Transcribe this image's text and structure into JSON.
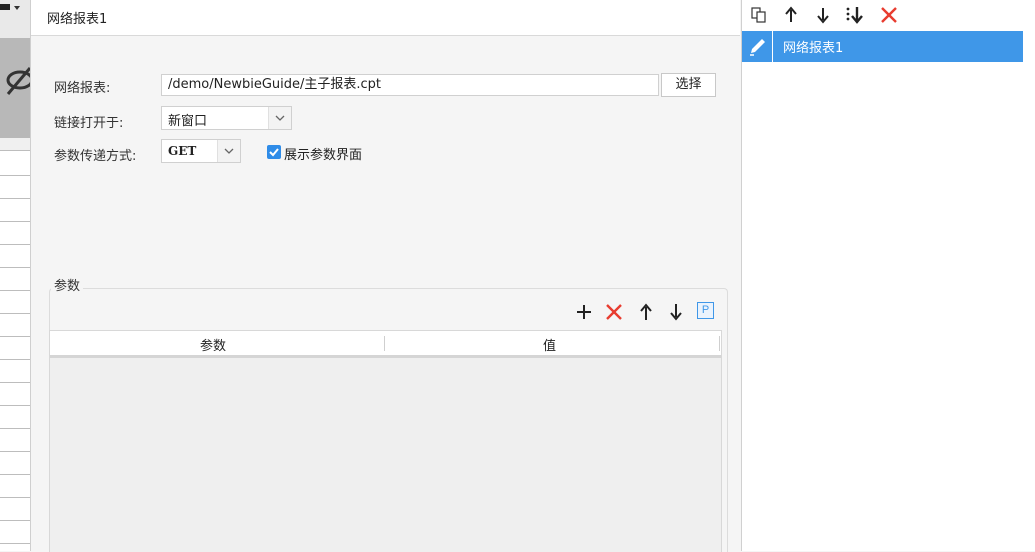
{
  "tab": {
    "title": "网络报表1"
  },
  "form": {
    "report_label": "网络报表:",
    "report_path": "/demo/NewbieGuide/主子报表.cpt",
    "select_button": "选择",
    "open_label": "链接打开于:",
    "open_value": "新窗口",
    "method_label": "参数传递方式:",
    "method_value": "GET",
    "show_params_label": "展示参数界面",
    "show_params_checked": true
  },
  "params": {
    "section_title": "参数",
    "columns": [
      "参数",
      "值"
    ],
    "toolbar": [
      "add-icon",
      "delete-icon",
      "move-up-icon",
      "move-down-icon",
      "parameter-icon"
    ],
    "parameter_icon_letter": "P"
  },
  "right_panel": {
    "toolbar": [
      "copy-icon",
      "move-up-icon",
      "move-down-icon",
      "sort-icon",
      "delete-icon"
    ],
    "items": [
      {
        "label": "网络报表1",
        "selected": true
      }
    ]
  },
  "colors": {
    "accent": "#3f97e8",
    "delete": "#e83c2f",
    "checkbox": "#2f8ce8"
  }
}
